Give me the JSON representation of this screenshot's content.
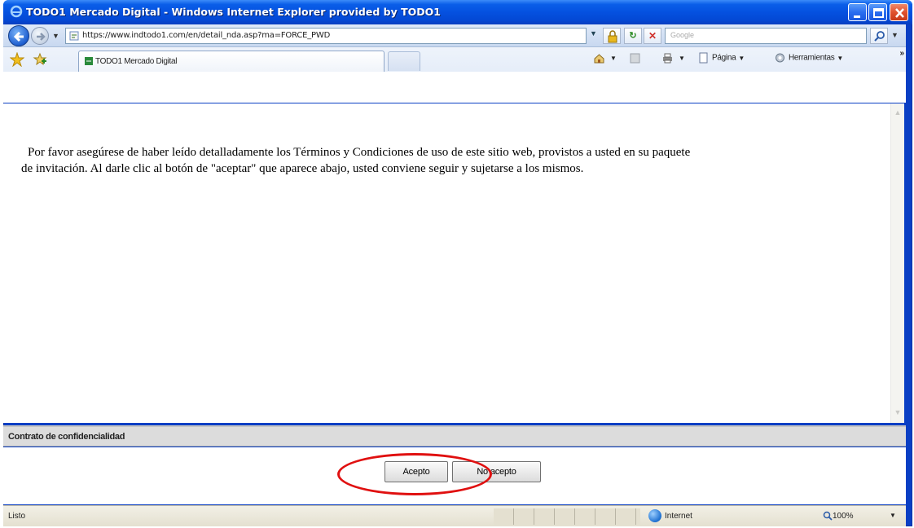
{
  "window": {
    "title": "TODO1 Mercado Digital - Windows Internet Explorer provided by TODO1"
  },
  "address_bar": {
    "url": "https://www.indtodo1.com/en/detail_nda.asp?ma=FORCE_PWD",
    "search_placeholder": "Google"
  },
  "command_bar": {
    "tab_label": "TODO1 Mercado Digital",
    "page_menu": "Página",
    "tools_menu": "Herramientas",
    "more": "»"
  },
  "page": {
    "notice_line1": "Por favor asegúrese de haber leído detalladamente los Términos y Condiciones de uso de este sitio web, provistos a usted en su paquete",
    "notice_line2": "de invitación. Al darle clic al botón de  \"aceptar\" que aparece abajo, usted conviene seguir y sujetarse a los mismos."
  },
  "frame": {
    "title": "Contrato de confidencialidad",
    "accept_label": "Acepto",
    "decline_label": "No acepto"
  },
  "status_bar": {
    "status": "Listo",
    "zone": "Internet",
    "zoom": "100%"
  },
  "icons": {
    "title": "ie-logo-icon",
    "back": "back-arrow-icon",
    "forward": "forward-arrow-icon",
    "lock": "lock-icon",
    "refresh": "refresh-icon",
    "stop": "stop-icon",
    "search": "search-icon",
    "favorites": "favorites-star-icon",
    "add_favorites": "add-favorites-icon",
    "home": "home-icon",
    "feeds": "feeds-icon",
    "print": "print-icon",
    "page": "page-icon",
    "tools": "tools-icon",
    "zone": "internet-zone-icon",
    "zoom": "zoom-icon"
  },
  "colors": {
    "titlebar": "#0551e0",
    "annotation_circle": "#e01010",
    "frame_header": "#dcdcdc"
  }
}
